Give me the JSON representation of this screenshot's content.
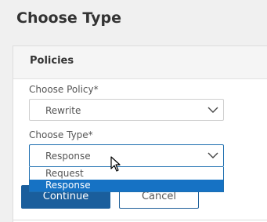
{
  "page": {
    "title": "Choose Type"
  },
  "panel": {
    "title": "Policies"
  },
  "policy_field": {
    "label": "Choose Policy*",
    "value": "Rewrite"
  },
  "type_field": {
    "label": "Choose Type*",
    "value": "Response",
    "options": [
      "Request",
      "Response"
    ],
    "selected_index": 1
  },
  "buttons": {
    "continue": "Continue",
    "cancel": "Cancel"
  },
  "colors": {
    "primary": "#1a5e9c",
    "highlight": "#1672c4",
    "focus_border": "#1e6fb0"
  }
}
